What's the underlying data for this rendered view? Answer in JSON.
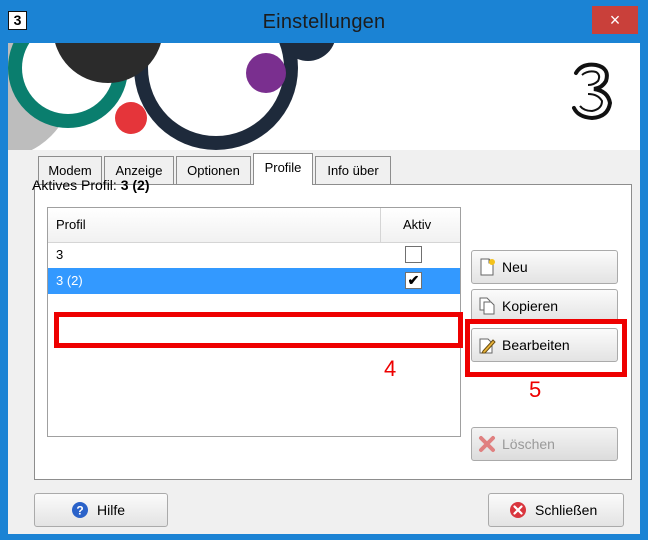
{
  "window": {
    "title": "Einstellungen",
    "app_icon_glyph": "3",
    "close_glyph": "×"
  },
  "tabs": [
    {
      "label": "Modem"
    },
    {
      "label": "Anzeige"
    },
    {
      "label": "Optionen"
    },
    {
      "label": "Profile",
      "active": true
    },
    {
      "label": "Info über"
    }
  ],
  "profile": {
    "active_label": "Aktives Profil:",
    "active_value": "3 (2)"
  },
  "table": {
    "headers": {
      "profile": "Profil",
      "active": "Aktiv"
    },
    "rows": [
      {
        "profile": "3",
        "active": false,
        "selected": false
      },
      {
        "profile": "3 (2)",
        "active": true,
        "selected": true
      }
    ]
  },
  "buttons": {
    "new": "Neu",
    "copy": "Kopieren",
    "edit": "Bearbeiten",
    "delete": "Löschen",
    "help": "Hilfe",
    "close": "Schließen"
  },
  "annotations": {
    "row_marker": "4",
    "edit_marker": "5"
  },
  "checkmark_glyph": "✔",
  "colors": {
    "titlebar": "#1b83d4",
    "close_button": "#c9403a",
    "selection": "#3399ff",
    "annotation": "#ee0000"
  }
}
